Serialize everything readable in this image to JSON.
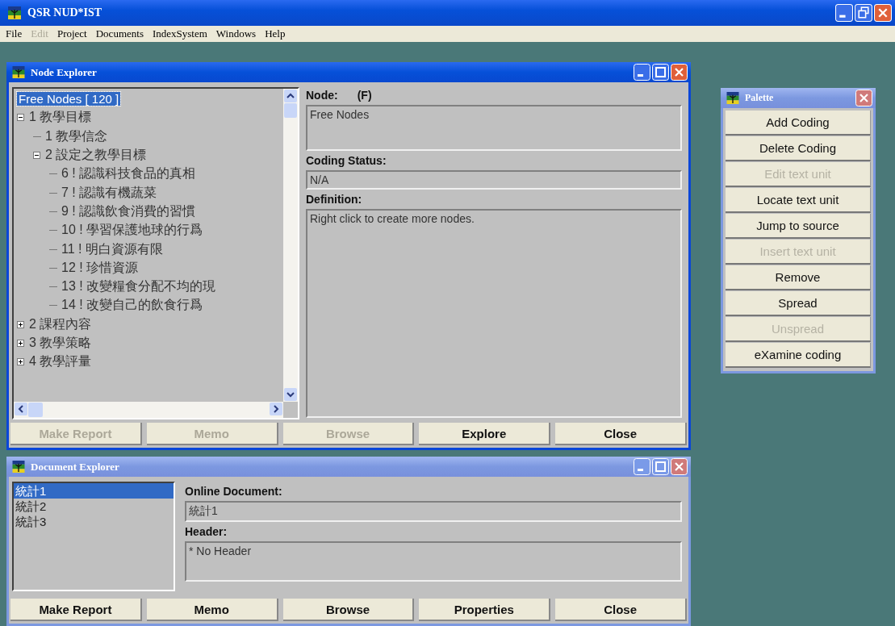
{
  "app": {
    "title": "QSR NUD*IST",
    "menu": [
      {
        "label": "File",
        "disabled": false
      },
      {
        "label": "Edit",
        "disabled": true
      },
      {
        "label": "Project",
        "disabled": false
      },
      {
        "label": "Documents",
        "disabled": false
      },
      {
        "label": "IndexSystem",
        "disabled": false
      },
      {
        "label": "Windows",
        "disabled": false
      },
      {
        "label": "Help",
        "disabled": false
      }
    ]
  },
  "node_explorer": {
    "title": "Node Explorer",
    "active": true,
    "tree": [
      {
        "label": "Free Nodes [ 120 ]",
        "selected": true
      },
      {
        "label": "1  教學目標",
        "selected": false,
        "expanded": true,
        "children": [
          {
            "label": "1  教學信念",
            "selected": false
          },
          {
            "label": "2  設定之教學目標",
            "selected": false,
            "expanded": true,
            "children": [
              {
                "label": "6 ! 認識科技食品的真相",
                "selected": false
              },
              {
                "label": "7 ! 認識有機蔬菜",
                "selected": false
              },
              {
                "label": "9 ! 認識飲食消費的習慣",
                "selected": false
              },
              {
                "label": "10 ! 學習保護地球的行爲",
                "selected": false
              },
              {
                "label": "11 ! 明白資源有限",
                "selected": false
              },
              {
                "label": "12 ! 珍惜資源",
                "selected": false
              },
              {
                "label": "13 ! 改變糧食分配不均的現",
                "selected": false
              },
              {
                "label": "14 ! 改變自己的飲食行爲",
                "selected": false
              }
            ]
          }
        ]
      },
      {
        "label": "2  課程內容",
        "selected": false,
        "expanded": false
      },
      {
        "label": "3  教學策略",
        "selected": false,
        "expanded": false
      },
      {
        "label": "4  教學評量",
        "selected": false,
        "expanded": false
      }
    ],
    "node_label": "Node:",
    "node_type": "(F)",
    "node_value": "Free Nodes",
    "coding_status_label": "Coding Status:",
    "coding_status_value": "N/A",
    "definition_label": "Definition:",
    "definition_value": "Right click to create more nodes.",
    "buttons": [
      {
        "label": "Make Report",
        "disabled": true
      },
      {
        "label": "Memo",
        "disabled": true
      },
      {
        "label": "Browse",
        "disabled": true
      },
      {
        "label": "Explore",
        "disabled": false
      },
      {
        "label": "Close",
        "disabled": false
      }
    ]
  },
  "document_explorer": {
    "title": "Document Explorer",
    "active": false,
    "documents": [
      {
        "label": "統計1",
        "selected": true
      },
      {
        "label": "統計2",
        "selected": false
      },
      {
        "label": "統計3",
        "selected": false
      }
    ],
    "online_document_label": "Online Document:",
    "online_document_value": "統計1",
    "header_label": "Header:",
    "header_value": "* No Header",
    "buttons": [
      {
        "label": "Make Report",
        "disabled": false
      },
      {
        "label": "Memo",
        "disabled": false
      },
      {
        "label": "Browse",
        "disabled": false
      },
      {
        "label": "Properties",
        "disabled": false
      },
      {
        "label": "Close",
        "disabled": false
      }
    ]
  },
  "palette": {
    "title": "Palette",
    "active": false,
    "buttons": [
      {
        "label": "Add Coding",
        "disabled": false
      },
      {
        "label": "Delete Coding",
        "disabled": false
      },
      {
        "label": "Edit text unit",
        "disabled": true
      },
      {
        "label": "Locate text unit",
        "disabled": false
      },
      {
        "label": "Jump to source",
        "disabled": false
      },
      {
        "label": "Insert text unit",
        "disabled": true
      },
      {
        "label": "Remove",
        "disabled": false
      },
      {
        "label": "Spread",
        "disabled": false
      },
      {
        "label": "Unspread",
        "disabled": true
      },
      {
        "label": "eXamine coding",
        "disabled": false
      }
    ]
  }
}
